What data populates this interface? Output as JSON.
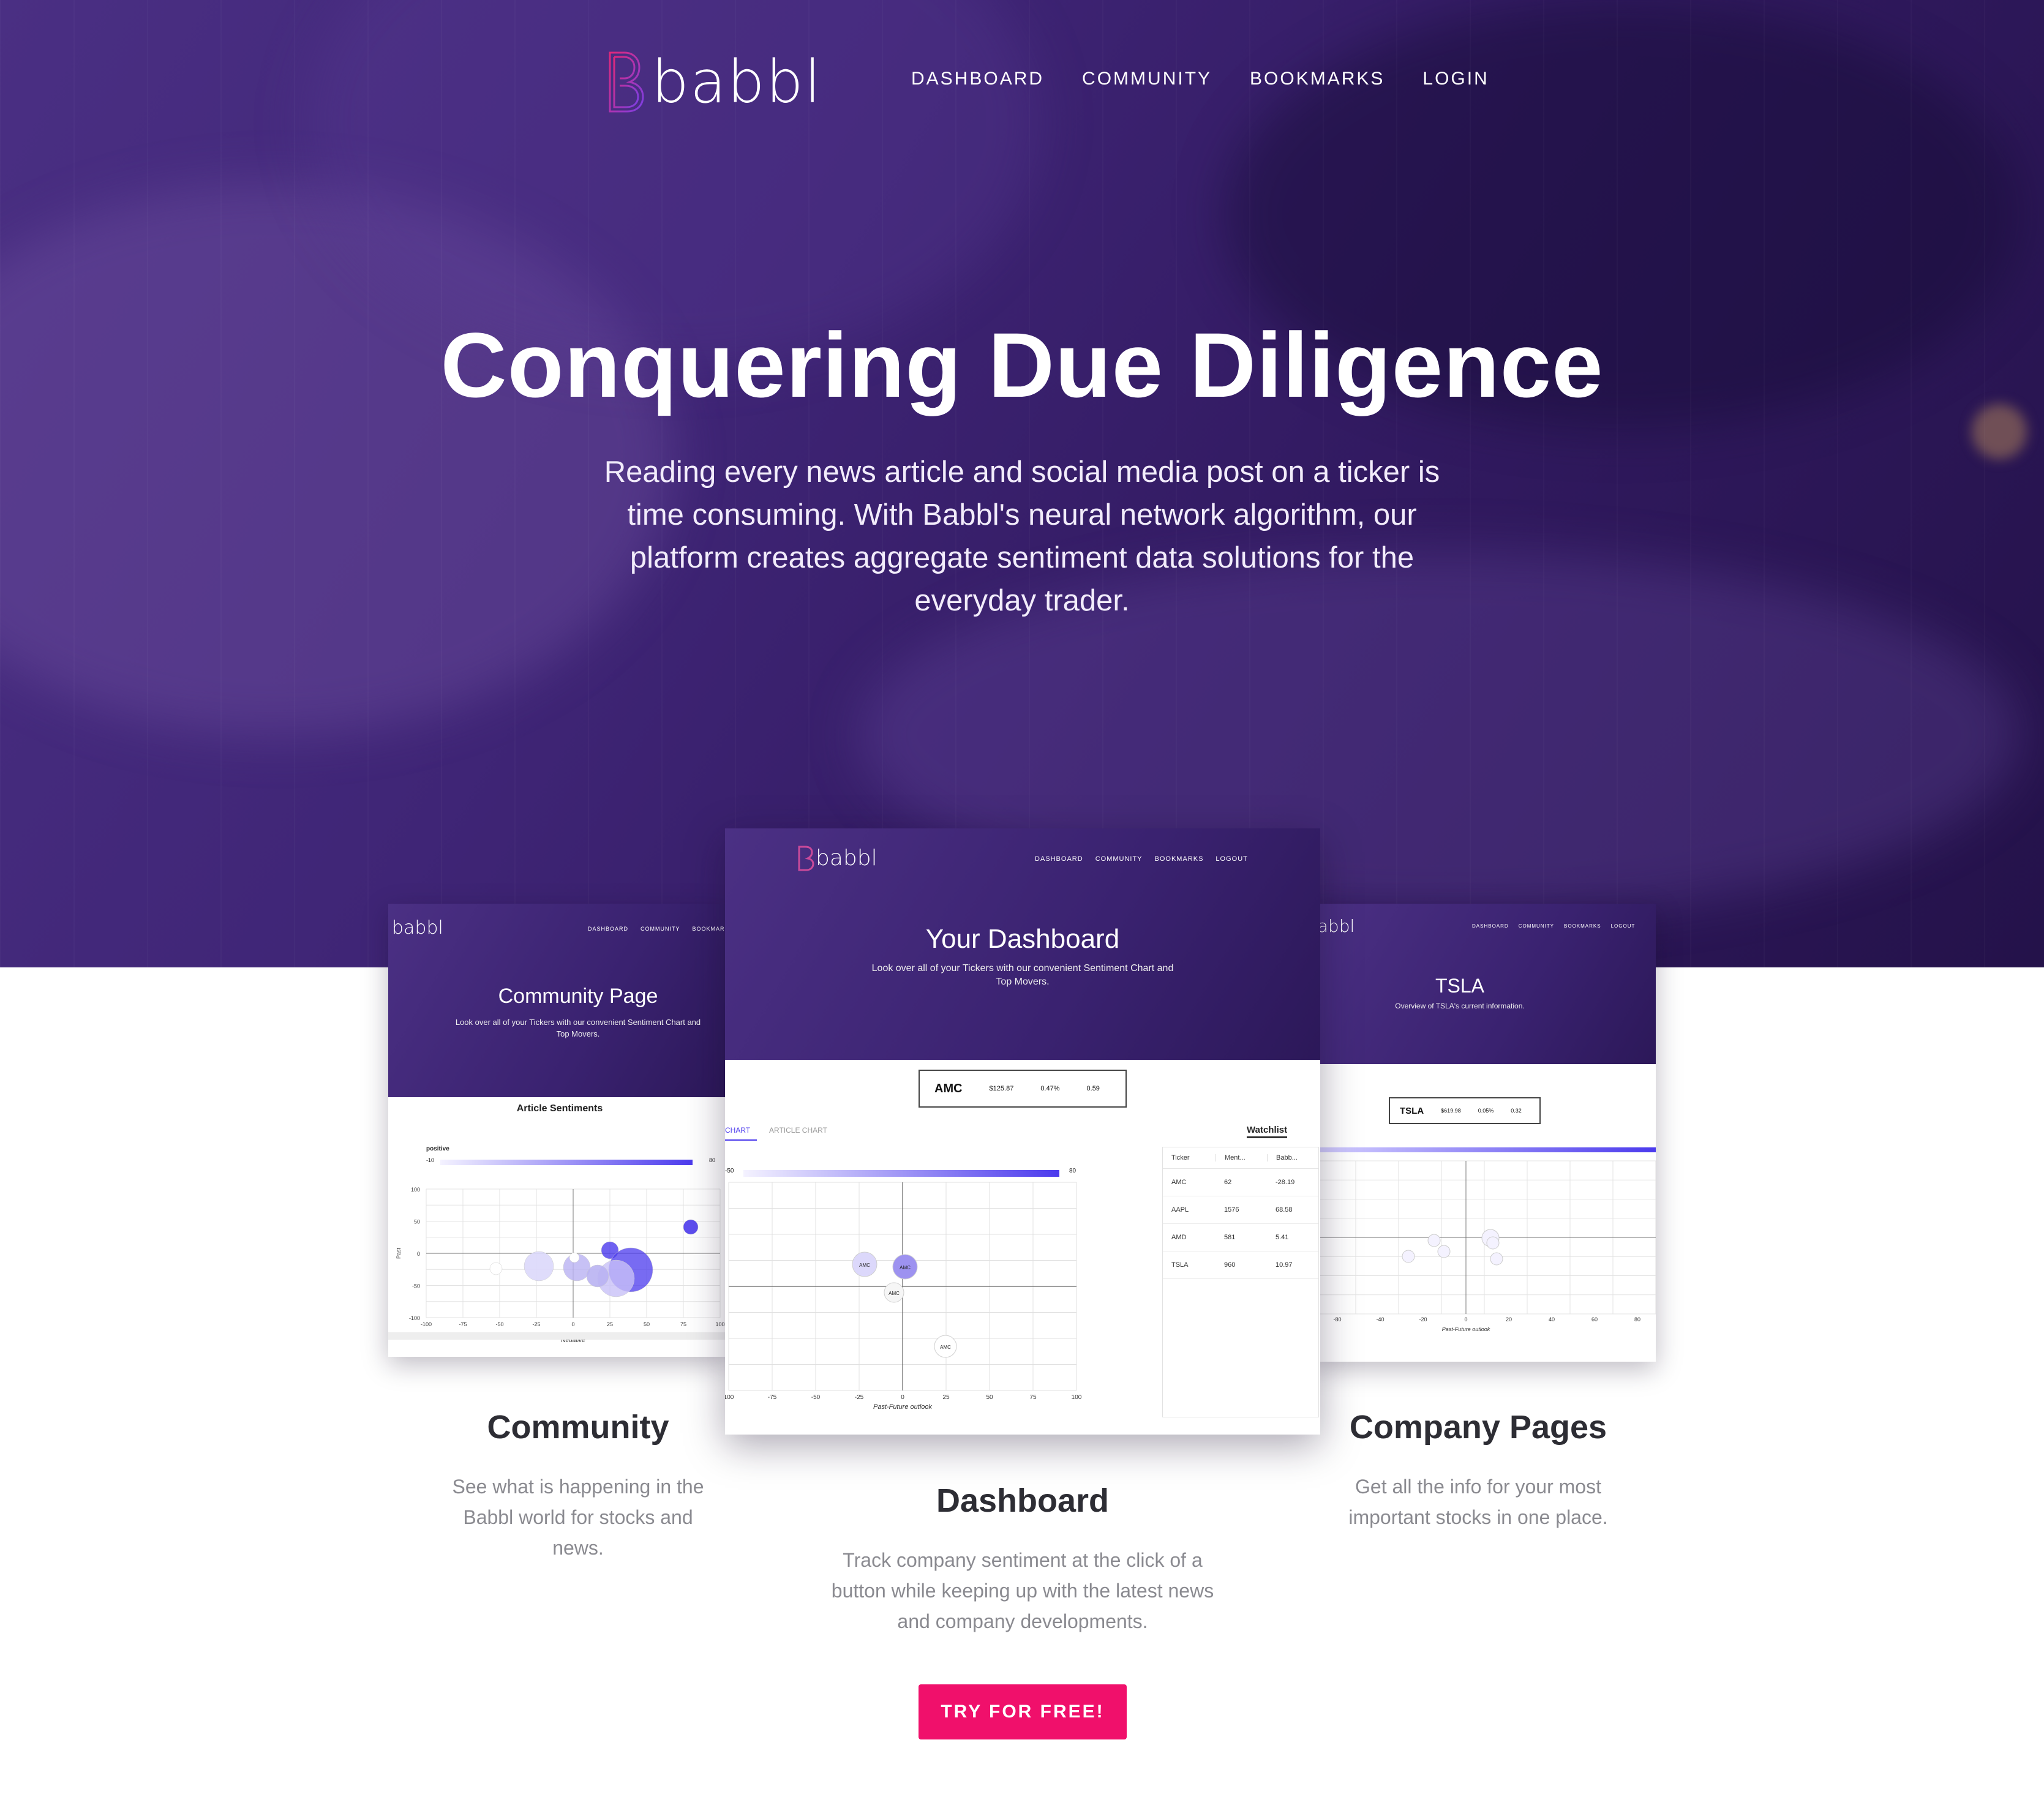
{
  "brand": {
    "name": "babbl"
  },
  "nav": {
    "items": [
      "DASHBOARD",
      "COMMUNITY",
      "BOOKMARKS",
      "LOGIN"
    ]
  },
  "hero": {
    "title": "Conquering Due Diligence",
    "subtitle": "Reading every news article and social media post on a ticker is time consuming. With Babbl's neural network algorithm, our platform creates aggregate sentiment data solutions for the everyday trader."
  },
  "colors": {
    "hero_purple": "#3f2576",
    "accent_blue": "#4b3aed",
    "cta_pink": "#f0106b"
  },
  "preview_community": {
    "logo": "babbl",
    "nav": [
      "DASHBOARD",
      "COMMUNITY",
      "BOOKMARKS"
    ],
    "title": "Community Page",
    "subtitle": "Look over all of your Tickers with our convenient Sentiment Chart and Top Movers.",
    "chart_title": "Article Sentiments",
    "gradient_label": "positive",
    "gradient_min": "-10",
    "gradient_max": "80",
    "y_ticks": [
      "100",
      "50",
      "0",
      "-50",
      "-100"
    ],
    "x_ticks": [
      "-100",
      "-75",
      "-50",
      "-25",
      "0",
      "25",
      "50",
      "75",
      "100"
    ],
    "y_label": "Past",
    "x_label": "Negative"
  },
  "preview_dashboard": {
    "logo": "babbl",
    "nav": [
      "DASHBOARD",
      "COMMUNITY",
      "BOOKMARKS",
      "LOGOUT"
    ],
    "title": "Your Dashboard",
    "subtitle": "Look over all of your Tickers with our convenient Sentiment Chart and Top Movers.",
    "ticker": {
      "symbol": "AMC",
      "price": "$125.87",
      "change": "0.47%",
      "score": "0.59"
    },
    "tabs": [
      "CHART",
      "ARTICLE CHART"
    ],
    "watchlist_title": "Watchlist",
    "gradient_min": "-50",
    "gradient_max": "80",
    "x_ticks": [
      "100",
      "-75",
      "-50",
      "-25",
      "0",
      "25",
      "50",
      "75",
      "100"
    ],
    "x_label": "Past-Future outlook",
    "watchlist": {
      "headers": [
        "Ticker",
        "Ment...",
        "Babb..."
      ],
      "rows": [
        [
          "AMC",
          "62",
          "-28.19"
        ],
        [
          "AAPL",
          "1576",
          "68.58"
        ],
        [
          "AMD",
          "581",
          "5.41"
        ],
        [
          "TSLA",
          "960",
          "10.97"
        ]
      ]
    }
  },
  "preview_company": {
    "logo": "babbl",
    "nav": [
      "DASHBOARD",
      "COMMUNITY",
      "BOOKMARKS",
      "LOGOUT"
    ],
    "title": "TSLA",
    "subtitle": "Overview of TSLA's current information.",
    "ticker": {
      "symbol": "TSLA",
      "price": "$619.98",
      "change": "0.05%",
      "score": "0.32"
    },
    "x_ticks": [
      "-80",
      "-40",
      "-20",
      "0",
      "20",
      "40",
      "60",
      "80"
    ],
    "x_label": "Past-Future outlook"
  },
  "features": [
    {
      "title": "Community",
      "desc": "See what is happening in the Babbl world for stocks and news."
    },
    {
      "title": "Dashboard",
      "desc": "Track company sentiment at the click of a button while keeping up with the latest news and company developments."
    },
    {
      "title": "Company Pages",
      "desc": "Get all the info for your most important stocks in one place."
    }
  ],
  "cta": {
    "label": "TRY FOR FREE!"
  }
}
